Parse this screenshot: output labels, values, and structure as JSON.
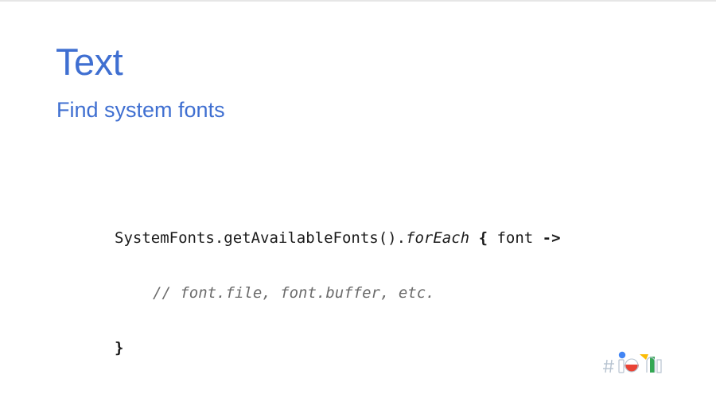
{
  "slide": {
    "title": "Text",
    "subtitle": "Find system fonts",
    "code": {
      "line1_receiver": "SystemFonts.getAvailableFonts().",
      "line1_call": "forEach",
      "line1_open_brace": "{",
      "line1_param": " font ",
      "line1_arrow": "->",
      "line2_comment": "// font.file, font.buffer, etc.",
      "line3_close_brace": "}"
    },
    "logo": {
      "icon": "google-io-logo-icon",
      "colors": {
        "blue": "#4285f4",
        "red": "#ea4335",
        "yellow": "#fbbc04",
        "green": "#34a853",
        "gray": "#b7c3d0"
      }
    }
  },
  "theme": {
    "accent": "#3f6fd1",
    "text": "#1a1a1a",
    "comment": "#6b6b6b",
    "background": "#ffffff"
  }
}
